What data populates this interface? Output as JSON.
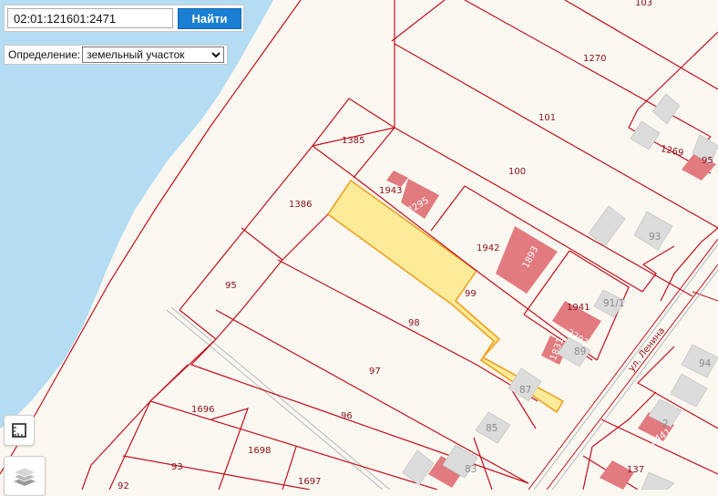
{
  "search": {
    "value": "02:01:121601:2471",
    "button_label": "Найти"
  },
  "definition": {
    "label": "Определение:",
    "selected": "земельный участок"
  },
  "colors": {
    "water": "#b4dcf3",
    "parcel_border": "#c0111e",
    "highlight_fill": "#fde98a",
    "highlight_border": "#f0a020",
    "building_cadastral": "#e27b7f",
    "building_other": "#dcdcdc",
    "accent": "#1b7fd3"
  },
  "parcel_labels": [
    "103",
    "1270",
    "101",
    "1385",
    "100",
    "1269",
    "95",
    "1943",
    "2295",
    "1386",
    "1942",
    "1893",
    "93",
    "99",
    "1941",
    "91/1",
    "95",
    "98",
    "2293",
    "1831",
    "89",
    "97",
    "87",
    "94",
    "1696",
    "96",
    "85",
    "2",
    "2441",
    "1698",
    "93",
    "83",
    "137",
    "92",
    "1697"
  ],
  "street_label": "ул. Ленина",
  "icons": {
    "measure": "ruler-icon",
    "layers": "layers-icon"
  }
}
